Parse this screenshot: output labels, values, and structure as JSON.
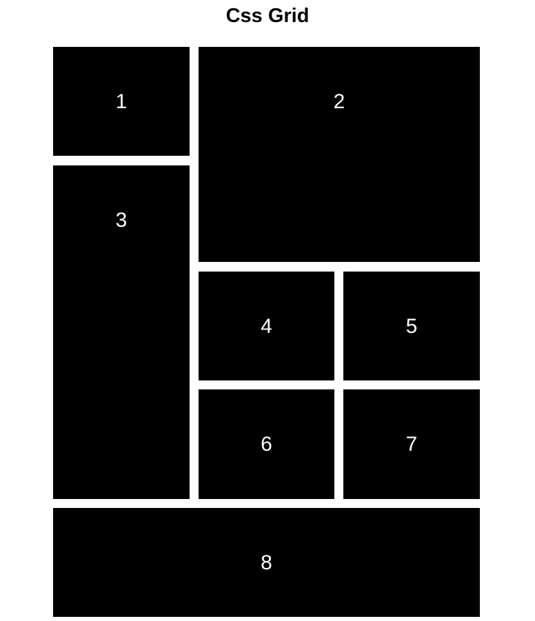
{
  "title": "Css Grid",
  "colors": {
    "cell_background": "#000000",
    "cell_text": "#ffffff",
    "page_background": "#ffffff"
  },
  "cells": [
    {
      "label": "1"
    },
    {
      "label": "2"
    },
    {
      "label": "3"
    },
    {
      "label": "4"
    },
    {
      "label": "5"
    },
    {
      "label": "6"
    },
    {
      "label": "7"
    },
    {
      "label": "8"
    }
  ]
}
